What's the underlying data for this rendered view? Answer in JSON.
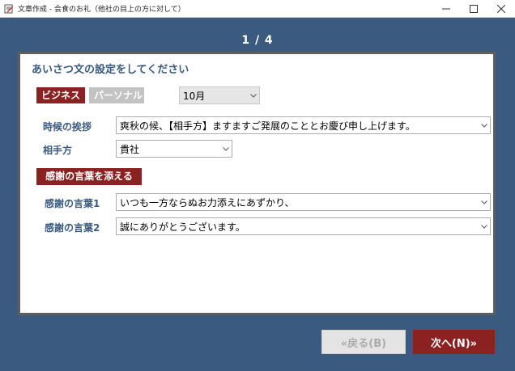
{
  "window": {
    "title": "文章作成 - 会食のお礼（他社の目上の方に対して）"
  },
  "header": {
    "page_indicator": "1 / 4"
  },
  "panel": {
    "title": "あいさつ文の設定をしてください",
    "tabs": [
      {
        "label": "ビジネス",
        "active": true
      },
      {
        "label": "パーソナル",
        "active": false
      }
    ],
    "month": {
      "value": "10月"
    },
    "seasonal_greeting": {
      "label": "時候の挨拶",
      "value": "爽秋の候、【相手方】ますますご発展のこととお慶び申し上げます。"
    },
    "recipient": {
      "label": "相手方",
      "value": "貴社"
    },
    "thanks_section_label": "感謝の言葉を添える",
    "thanks1": {
      "label": "感謝の言葉1",
      "value": "いつも一方ならぬお力添えにあずかり、"
    },
    "thanks2": {
      "label": "感謝の言葉2",
      "value": "誠にありがとうございます。"
    }
  },
  "footer": {
    "back_label": "«戻る(B)",
    "next_label": "次へ(N)»"
  },
  "colors": {
    "accent": "#8b2121",
    "frame": "#3a5a80",
    "disabled": "#c3c3c3"
  },
  "icons": [
    "document-edit-icon",
    "minimize-icon",
    "maximize-icon",
    "close-icon",
    "chevron-down-icon"
  ]
}
